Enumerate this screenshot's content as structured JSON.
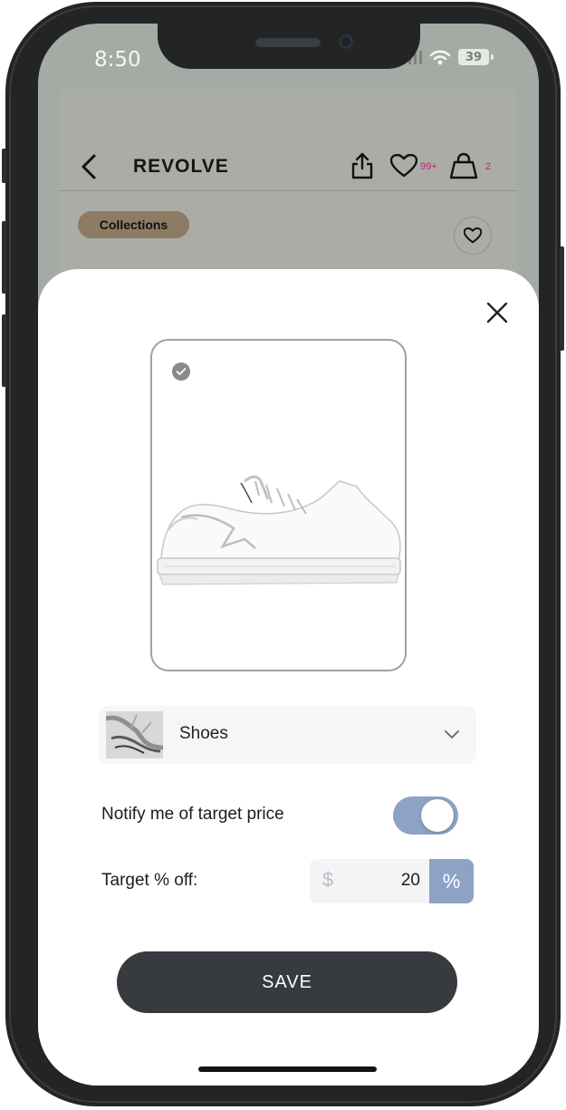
{
  "status_bar": {
    "time": "8:50",
    "battery": "39"
  },
  "header": {
    "brand": "REVOLVE",
    "wishlist_count": "99+",
    "bag_count": "2"
  },
  "chip": {
    "label": "Collections"
  },
  "category": {
    "label": "Shoes"
  },
  "notify": {
    "label": "Notify me of target price",
    "enabled": true
  },
  "target": {
    "label": "Target % off:",
    "currency_symbol": "$",
    "value": "20",
    "percent_symbol": "%"
  },
  "save": {
    "label": "SAVE"
  },
  "colors": {
    "accent": "#8ea2c6",
    "save_button": "#373a3f",
    "chip": "#8e7b63",
    "badge": "#c41f7b"
  }
}
